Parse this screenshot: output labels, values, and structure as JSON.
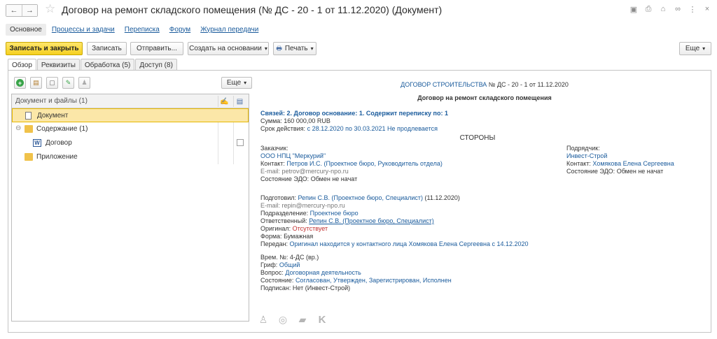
{
  "window": {
    "title": "Договор на ремонт складского помещения (№ ДС - 20 - 1 от 11.12.2020) (Документ)",
    "back_glyph": "←",
    "forward_glyph": "→",
    "star_glyph": "☆",
    "icons": [
      "save-icon",
      "print-icon",
      "attach-icon",
      "link-icon",
      "more-icon",
      "close-icon"
    ],
    "icon_glyphs": {
      "save": "▣",
      "print": "⎙",
      "attach": "⌂",
      "link": "∞",
      "more": "⋮",
      "close": "×"
    }
  },
  "sections": [
    "Основное",
    "Процессы и задачи",
    "Переписка",
    "Форум",
    "Журнал передачи"
  ],
  "toolbar": {
    "save_close": "Записать и закрыть",
    "save": "Записать",
    "send": "Отправить...",
    "create_based": "Создать на основании",
    "print": "Печать",
    "more": "Еще",
    "dropdown_glyph": "▾",
    "print_glyph": "🖶"
  },
  "tabs": [
    "Обзор",
    "Реквизиты",
    "Обработка (5)",
    "Доступ (8)"
  ],
  "left": {
    "more": "Еще",
    "tool_glyphs": {
      "add": "+",
      "paste": "▤",
      "new": "▢",
      "edit": "✎",
      "stamp": "♟"
    },
    "grid_header": "Документ и файлы (1)",
    "header_icon_glyphs": {
      "signature": "✍",
      "file": "▤"
    },
    "tree_glyphs": {
      "expand": "⊖",
      "word": "W"
    },
    "rows": [
      {
        "label": "Документ"
      },
      {
        "label": "Содержание (1)"
      },
      {
        "label": "Договор"
      },
      {
        "label": "Приложение"
      }
    ]
  },
  "preview": {
    "header_link": "ДОГОВОР СТРОИТЕЛЬСТВА",
    "header_rest": "№ ДС - 20 - 1 от 11.12.2020",
    "doc_title": "Договор на ремонт складского помещения",
    "links_line": "Связей: 2. Договор основание: 1. Содержит переписку по: 1",
    "sum_label": "Сумма:",
    "sum_value": "160 000,00 RUB",
    "term_label": "Срок действия:",
    "term_value": "с 28.12.2020 по 30.03.2021 Не продлевается",
    "parties": "СТОРОНЫ",
    "customer_label": "Заказчик:",
    "customer": "ООО НПЦ \"Меркурий\"",
    "customer_contact_label": "Контакт:",
    "customer_contact": "Петров И.С. (Проектное бюро, Руководитель отдела)",
    "customer_email_label": "E-mail:",
    "customer_email": "petrov@mercury-npo.ru",
    "customer_edo_label": "Состояние ЭДО:",
    "customer_edo": "Обмен не начат",
    "contractor_label": "Подрядчик:",
    "contractor": "Инвест-Строй",
    "contractor_contact_label": "Контакт:",
    "contractor_contact": "Хомякова Елена Сергеевна",
    "contractor_edo_label": "Состояние ЭДО:",
    "contractor_edo": "Обмен не начат",
    "prepared_label": "Подготовил:",
    "prepared": "Репин С.В. (Проектное бюро, Специалист)",
    "prepared_date": "(11.12.2020)",
    "prep_email_label": "E-mail:",
    "prep_email": "repin@mercury-npo.ru",
    "division_label": "Подразделение:",
    "division": "Проектное бюро",
    "responsible_label": "Ответственный:",
    "responsible": "Репин С.В. (Проектное бюро, Специалист)",
    "original_label": "Оригинал:",
    "original": "Отсутствует",
    "form_label": "Форма:",
    "form": "Бумажная",
    "transferred_label": "Передан:",
    "transferred": "Оригинал находится у контактного лица Хомякова Елена Сергеевна с 14.12.2020",
    "tempnum_label": "Врем. №:",
    "tempnum": "4-ДС (вр.)",
    "stamp_label": "Гриф:",
    "stamp": "Общий",
    "question_label": "Вопрос:",
    "question": "Договорная деятельность",
    "state_label": "Состояние:",
    "state": "Согласован, Утвержден, Зарегистрирован, Исполнен",
    "signed_label": "Подписан:",
    "signed": "Нет (Инвест-Строй)"
  },
  "bottom_icons": [
    "users-icon",
    "target-icon",
    "chat-icon",
    "k-icon"
  ],
  "bottom_glyphs": {
    "users": "♙",
    "target": "◎",
    "chat": "▰",
    "k": "K"
  },
  "colors": {
    "accent": "#f5d020",
    "link": "#1a5b9c",
    "selection": "#fbe7a8",
    "danger": "#c03030"
  }
}
